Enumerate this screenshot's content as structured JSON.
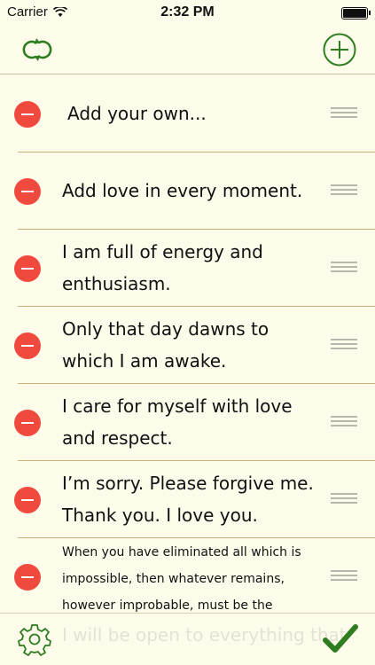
{
  "status_bar": {
    "carrier": "Carrier",
    "time": "2:32 PM"
  },
  "icons": {
    "refresh": "refresh-icon",
    "add": "plus-circle-icon",
    "delete": "minus-circle-icon",
    "reorder": "reorder-handle-icon",
    "settings": "gear-icon",
    "done": "checkmark-icon"
  },
  "colors": {
    "background": "#fdfbea",
    "accent_green": "#2e7d1f",
    "delete_red": "#f04a3e",
    "separator": "#c9b27a"
  },
  "affirmations": [
    {
      "text": "Add your own..."
    },
    {
      "text": "Add love in every moment."
    },
    {
      "text": "I am full of energy and enthusiasm."
    },
    {
      "text": "Only that day dawns to which I am awake."
    },
    {
      "text": "I care for myself with love and respect."
    },
    {
      "text": "I’m sorry. Please forgive me. Thank you. I love you."
    },
    {
      "text": "When you have eliminated all which is impossible, then whatever remains, however improbable, must be the truth."
    }
  ],
  "toolbar": {
    "partially_hidden_text": "I will be open to everything that"
  }
}
